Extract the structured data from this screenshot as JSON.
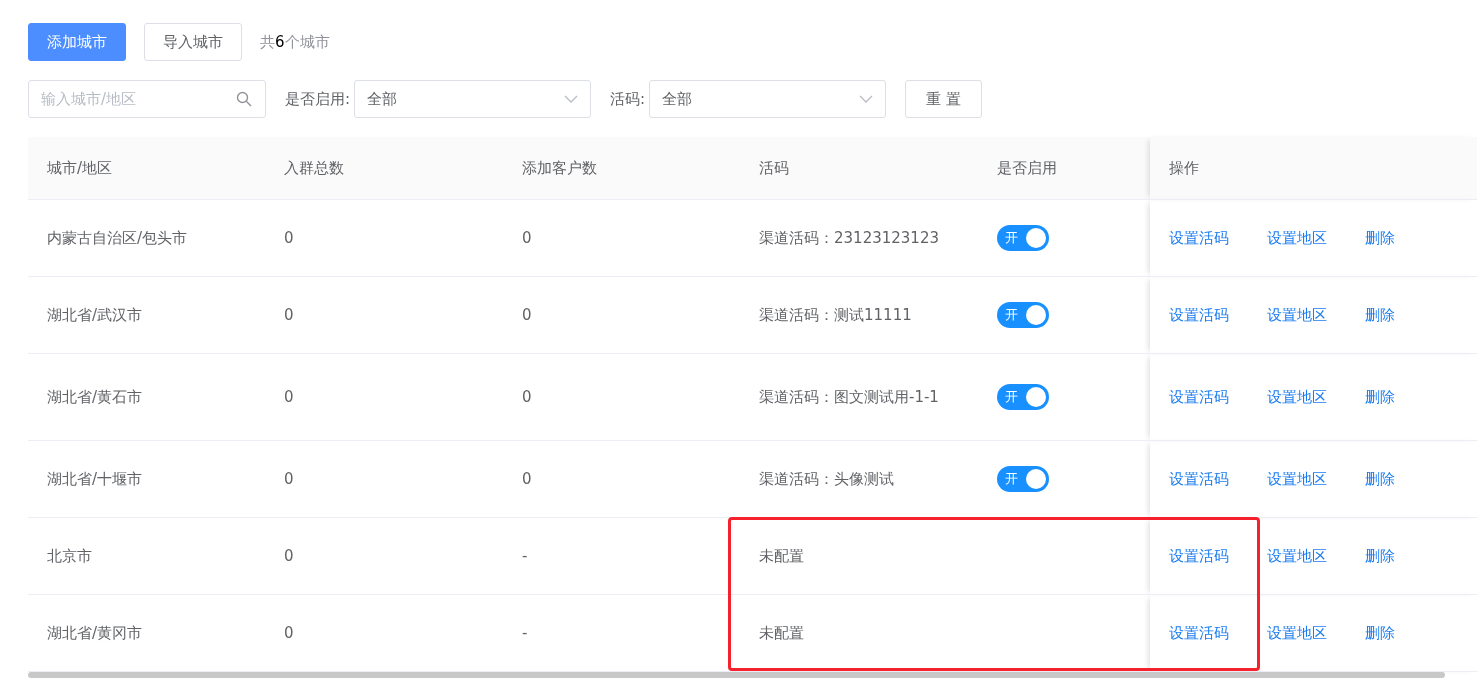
{
  "toolbar": {
    "add_button": "添加城市",
    "import_button": "导入城市",
    "count": "共**6**个城市"
  },
  "filters": {
    "search": {
      "placeholder": "输入城市/地区"
    },
    "enabled": {
      "label": "是否启用:",
      "value": "全部"
    },
    "code": {
      "label": "活码:",
      "value": "全部"
    },
    "reset_button": "重 置"
  },
  "table": {
    "columns": [
      "城市/地区",
      "入群总数",
      "添加客户数",
      "活码",
      "是否启用",
      "操作"
    ],
    "rows": [
      {
        "city": "内蒙古自治区/包头市",
        "group_total": "0",
        "customers_added": "0",
        "code": "渠道活码：23123123123",
        "toggle": {
          "on": true,
          "label": "开"
        },
        "actions": [
          "设置活码",
          "设置地区",
          "删除"
        ]
      },
      {
        "city": "湖北省/武汉市",
        "group_total": "0",
        "customers_added": "0",
        "code": "渠道活码：测试11111",
        "toggle": {
          "on": true,
          "label": "开"
        },
        "actions": [
          "设置活码",
          "设置地区",
          "删除"
        ]
      },
      {
        "city": "湖北省/黄石市",
        "group_total": "0",
        "customers_added": "0",
        "code": "渠道活码：图文测试用-1-1",
        "toggle": {
          "on": true,
          "label": "开"
        },
        "actions": [
          "设置活码",
          "设置地区",
          "删除"
        ]
      },
      {
        "city": "湖北省/十堰市",
        "group_total": "0",
        "customers_added": "0",
        "code": "渠道活码：头像测试",
        "toggle": {
          "on": true,
          "label": "开"
        },
        "actions": [
          "设置活码",
          "设置地区",
          "删除"
        ]
      },
      {
        "city": "北京市",
        "group_total": "0",
        "customers_added": "-",
        "code": "未配置",
        "actions": [
          "设置活码",
          "设置地区",
          "删除"
        ]
      },
      {
        "city": "湖北省/黄冈市",
        "group_total": "0",
        "customers_added": "-",
        "code": "未配置",
        "actions": [
          "设置活码",
          "设置地区",
          "删除"
        ]
      }
    ]
  }
}
